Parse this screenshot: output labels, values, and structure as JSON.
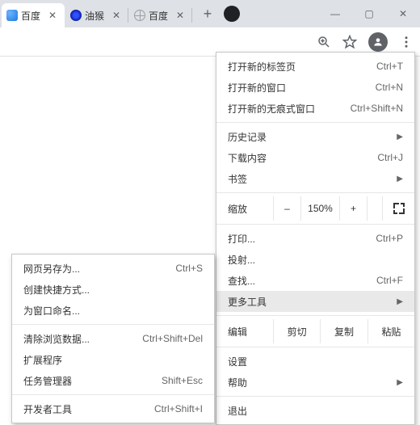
{
  "tabs": [
    {
      "title": "百度",
      "favicon": "baidu"
    },
    {
      "title": "油猴",
      "favicon": "baidu-paw"
    },
    {
      "title": "百度",
      "favicon": "globe"
    }
  ],
  "toolbar": {
    "zoom_icon": "zoom",
    "star_icon": "star",
    "profile_icon": "profile",
    "menu_icon": "more-vert"
  },
  "main_menu": {
    "new_tab": {
      "label": "打开新的标签页",
      "shortcut": "Ctrl+T"
    },
    "new_window": {
      "label": "打开新的窗口",
      "shortcut": "Ctrl+N"
    },
    "new_incognito": {
      "label": "打开新的无痕式窗口",
      "shortcut": "Ctrl+Shift+N"
    },
    "history": {
      "label": "历史记录"
    },
    "downloads": {
      "label": "下载内容",
      "shortcut": "Ctrl+J"
    },
    "bookmarks": {
      "label": "书签"
    },
    "zoom_label": "缩放",
    "zoom_minus": "–",
    "zoom_value": "150%",
    "zoom_plus": "+",
    "print": {
      "label": "打印...",
      "shortcut": "Ctrl+P"
    },
    "cast": {
      "label": "投射..."
    },
    "find": {
      "label": "查找...",
      "shortcut": "Ctrl+F"
    },
    "more_tools": {
      "label": "更多工具"
    },
    "edit_label": "编辑",
    "cut": "剪切",
    "copy": "复制",
    "paste": "粘贴",
    "settings": {
      "label": "设置"
    },
    "help": {
      "label": "帮助"
    },
    "exit": {
      "label": "退出"
    }
  },
  "sub_menu": {
    "save_as": {
      "label": "网页另存为...",
      "shortcut": "Ctrl+S"
    },
    "create_shortcut": {
      "label": "创建快捷方式..."
    },
    "name_window": {
      "label": "为窗口命名..."
    },
    "clear_data": {
      "label": "清除浏览数据...",
      "shortcut": "Ctrl+Shift+Del"
    },
    "extensions": {
      "label": "扩展程序"
    },
    "task_manager": {
      "label": "任务管理器",
      "shortcut": "Shift+Esc"
    },
    "dev_tools": {
      "label": "开发者工具",
      "shortcut": "Ctrl+Shift+I"
    }
  }
}
